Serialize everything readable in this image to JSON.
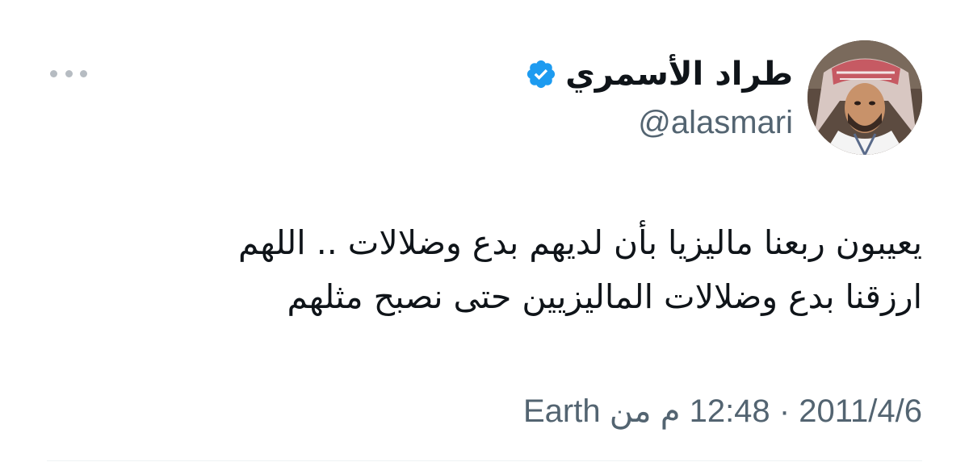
{
  "tweet": {
    "author": {
      "display_name": "طراد الأسمري",
      "handle": "@alasmari",
      "verified": true,
      "verified_icon": "verified-badge-icon",
      "avatar_icon": "avatar"
    },
    "more_icon": "ellipsis-icon",
    "text_lines": [
      "يعيبون ربعنا ماليزيا بأن لديهم بدع وضلالات .. اللهم",
      "ارزقنا بدع وضلالات الماليزيين حتى نصبح مثلهم"
    ],
    "date": "2011/4/6",
    "separator": "·",
    "time": "12:48 م من",
    "source": "Earth",
    "colors": {
      "text": "#0f1419",
      "secondary": "#536471",
      "verified": "#1d9bf0",
      "more_dots": "#b6bcc2"
    }
  }
}
